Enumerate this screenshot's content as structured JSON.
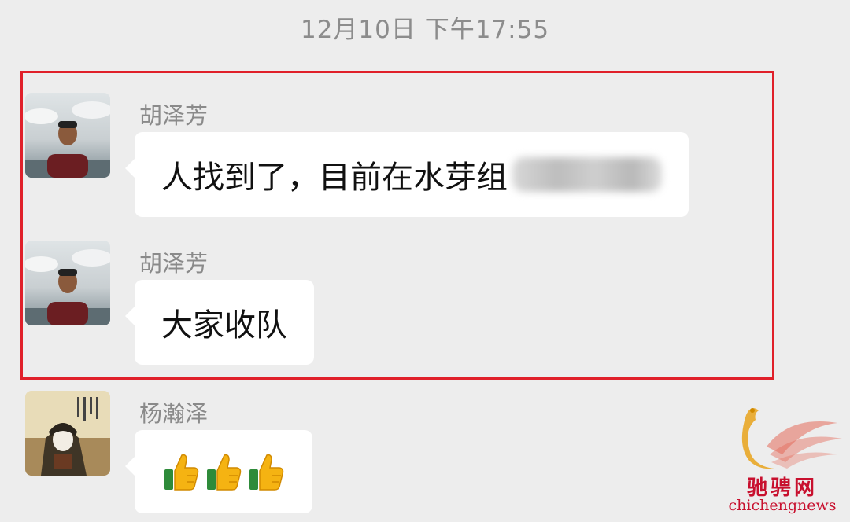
{
  "chat": {
    "timestamp": "12月10日 下午17:55",
    "messages": [
      {
        "sender": "胡泽芳",
        "text": "人找到了，目前在水芽组",
        "redacted_suffix": true
      },
      {
        "sender": "胡泽芳",
        "text": "大家收队"
      },
      {
        "sender": "杨瀚泽",
        "emoji": [
          "thumbs-up-icon",
          "thumbs-up-icon",
          "thumbs-up-icon"
        ]
      }
    ]
  },
  "watermark": {
    "title": "驰骋网",
    "subtitle": "chichengnews"
  },
  "colors": {
    "background": "#ededed",
    "bubble": "#ffffff",
    "highlight_border": "#e0202a",
    "watermark": "#c8102e"
  }
}
